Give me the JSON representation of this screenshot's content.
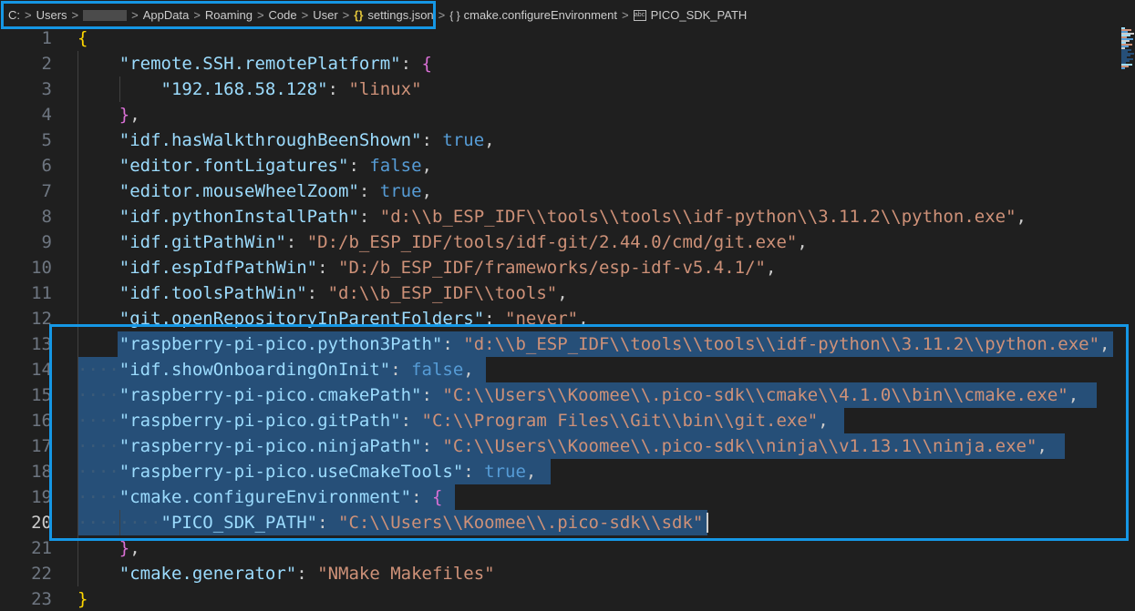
{
  "breadcrumb": {
    "items": [
      "C:",
      "Users",
      "AppData",
      "Roaming",
      "Code",
      "User"
    ],
    "file": "settings.json",
    "json_icon": "{}",
    "object_icon": "{ }",
    "symbol_object": "cmake.configureEnvironment",
    "symbol_key": "PICO_SDK_PATH",
    "separator": ">"
  },
  "colors": {
    "highlight_box": "#1597e5",
    "selection": "#264f78",
    "key": "#9cdcfe",
    "string": "#ce9178",
    "boolean": "#569cd6"
  },
  "editor": {
    "active_line": 20,
    "selection_start_line": 13,
    "selection_end_line": 20,
    "lines": [
      {
        "n": "1",
        "indent": 0,
        "tokens": [
          {
            "t": "{",
            "c": "br1"
          }
        ]
      },
      {
        "n": "2",
        "indent": 1,
        "tokens": [
          {
            "t": "\"remote.SSH.remotePlatform\"",
            "c": "k"
          },
          {
            "t": ": ",
            "c": "p"
          },
          {
            "t": "{",
            "c": "br2"
          }
        ]
      },
      {
        "n": "3",
        "indent": 2,
        "tokens": [
          {
            "t": "\"192.168.58.128\"",
            "c": "k"
          },
          {
            "t": ": ",
            "c": "p"
          },
          {
            "t": "\"linux\"",
            "c": "s"
          }
        ]
      },
      {
        "n": "4",
        "indent": 1,
        "tokens": [
          {
            "t": "}",
            "c": "br2"
          },
          {
            "t": ",",
            "c": "p"
          }
        ]
      },
      {
        "n": "5",
        "indent": 1,
        "tokens": [
          {
            "t": "\"idf.hasWalkthroughBeenShown\"",
            "c": "k"
          },
          {
            "t": ": ",
            "c": "p"
          },
          {
            "t": "true",
            "c": "b"
          },
          {
            "t": ",",
            "c": "p"
          }
        ]
      },
      {
        "n": "6",
        "indent": 1,
        "tokens": [
          {
            "t": "\"editor.fontLigatures\"",
            "c": "k"
          },
          {
            "t": ": ",
            "c": "p"
          },
          {
            "t": "false",
            "c": "b"
          },
          {
            "t": ",",
            "c": "p"
          }
        ]
      },
      {
        "n": "7",
        "indent": 1,
        "tokens": [
          {
            "t": "\"editor.mouseWheelZoom\"",
            "c": "k"
          },
          {
            "t": ": ",
            "c": "p"
          },
          {
            "t": "true",
            "c": "b"
          },
          {
            "t": ",",
            "c": "p"
          }
        ]
      },
      {
        "n": "8",
        "indent": 1,
        "tokens": [
          {
            "t": "\"idf.pythonInstallPath\"",
            "c": "k"
          },
          {
            "t": ": ",
            "c": "p"
          },
          {
            "t": "\"d:\\\\b_ESP_IDF\\\\tools\\\\tools\\\\idf-python\\\\3.11.2\\\\python.exe\"",
            "c": "s"
          },
          {
            "t": ",",
            "c": "p"
          }
        ]
      },
      {
        "n": "9",
        "indent": 1,
        "tokens": [
          {
            "t": "\"idf.gitPathWin\"",
            "c": "k"
          },
          {
            "t": ": ",
            "c": "p"
          },
          {
            "t": "\"D:/b_ESP_IDF/tools/idf-git/2.44.0/cmd/git.exe\"",
            "c": "s"
          },
          {
            "t": ",",
            "c": "p"
          }
        ]
      },
      {
        "n": "10",
        "indent": 1,
        "tokens": [
          {
            "t": "\"idf.espIdfPathWin\"",
            "c": "k"
          },
          {
            "t": ": ",
            "c": "p"
          },
          {
            "t": "\"D:/b_ESP_IDF/frameworks/esp-idf-v5.4.1/\"",
            "c": "s"
          },
          {
            "t": ",",
            "c": "p"
          }
        ]
      },
      {
        "n": "11",
        "indent": 1,
        "tokens": [
          {
            "t": "\"idf.toolsPathWin\"",
            "c": "k"
          },
          {
            "t": ": ",
            "c": "p"
          },
          {
            "t": "\"d:\\\\b_ESP_IDF\\\\tools\"",
            "c": "s"
          },
          {
            "t": ",",
            "c": "p"
          }
        ]
      },
      {
        "n": "12",
        "indent": 1,
        "tokens": [
          {
            "t": "\"git.openRepositoryInParentFolders\"",
            "c": "k"
          },
          {
            "t": ": ",
            "c": "p"
          },
          {
            "t": "\"never\"",
            "c": "s"
          },
          {
            "t": ",",
            "c": "p"
          }
        ]
      },
      {
        "n": "13",
        "indent": 1,
        "tokens": [
          {
            "t": "\"raspberry-pi-pico.python3Path\"",
            "c": "k"
          },
          {
            "t": ": ",
            "c": "p"
          },
          {
            "t": "\"d:\\\\b_ESP_IDF\\\\tools\\\\tools\\\\idf-python\\\\3.11.2\\\\python.exe\"",
            "c": "s"
          },
          {
            "t": ",",
            "c": "p"
          }
        ]
      },
      {
        "n": "14",
        "indent": 1,
        "tokens": [
          {
            "t": "\"idf.showOnboardingOnInit\"",
            "c": "k"
          },
          {
            "t": ": ",
            "c": "p"
          },
          {
            "t": "false",
            "c": "b"
          },
          {
            "t": ",",
            "c": "p"
          }
        ]
      },
      {
        "n": "15",
        "indent": 1,
        "tokens": [
          {
            "t": "\"raspberry-pi-pico.cmakePath\"",
            "c": "k"
          },
          {
            "t": ": ",
            "c": "p"
          },
          {
            "t": "\"C:\\\\Users\\\\Koomee\\\\.pico-sdk\\\\cmake\\\\4.1.0\\\\bin\\\\cmake.exe\"",
            "c": "s"
          },
          {
            "t": ",",
            "c": "p"
          }
        ]
      },
      {
        "n": "16",
        "indent": 1,
        "tokens": [
          {
            "t": "\"raspberry-pi-pico.gitPath\"",
            "c": "k"
          },
          {
            "t": ": ",
            "c": "p"
          },
          {
            "t": "\"C:\\\\Program Files\\\\Git\\\\bin\\\\git.exe\"",
            "c": "s"
          },
          {
            "t": ",",
            "c": "p"
          }
        ]
      },
      {
        "n": "17",
        "indent": 1,
        "tokens": [
          {
            "t": "\"raspberry-pi-pico.ninjaPath\"",
            "c": "k"
          },
          {
            "t": ": ",
            "c": "p"
          },
          {
            "t": "\"C:\\\\Users\\\\Koomee\\\\.pico-sdk\\\\ninja\\\\v1.13.1\\\\ninja.exe\"",
            "c": "s"
          },
          {
            "t": ",",
            "c": "p"
          }
        ]
      },
      {
        "n": "18",
        "indent": 1,
        "tokens": [
          {
            "t": "\"raspberry-pi-pico.useCmakeTools\"",
            "c": "k"
          },
          {
            "t": ": ",
            "c": "p"
          },
          {
            "t": "true",
            "c": "b"
          },
          {
            "t": ",",
            "c": "p"
          }
        ]
      },
      {
        "n": "19",
        "indent": 1,
        "tokens": [
          {
            "t": "\"cmake.configureEnvironment\"",
            "c": "k"
          },
          {
            "t": ": ",
            "c": "p"
          },
          {
            "t": "{",
            "c": "br2"
          }
        ]
      },
      {
        "n": "20",
        "indent": 2,
        "tokens": [
          {
            "t": "\"PICO_SDK_PATH\"",
            "c": "k"
          },
          {
            "t": ": ",
            "c": "p"
          },
          {
            "t": "\"C:\\\\Users\\\\Koomee\\\\.pico-sdk\\\\sdk\"",
            "c": "s"
          }
        ]
      },
      {
        "n": "21",
        "indent": 1,
        "tokens": [
          {
            "t": "}",
            "c": "br2"
          },
          {
            "t": ",",
            "c": "p"
          }
        ]
      },
      {
        "n": "22",
        "indent": 1,
        "tokens": [
          {
            "t": "\"cmake.generator\"",
            "c": "k"
          },
          {
            "t": ": ",
            "c": "p"
          },
          {
            "t": "\"NMake Makefiles\"",
            "c": "s"
          }
        ]
      },
      {
        "n": "23",
        "indent": 0,
        "tokens": [
          {
            "t": "}",
            "c": "br1"
          }
        ]
      }
    ]
  }
}
